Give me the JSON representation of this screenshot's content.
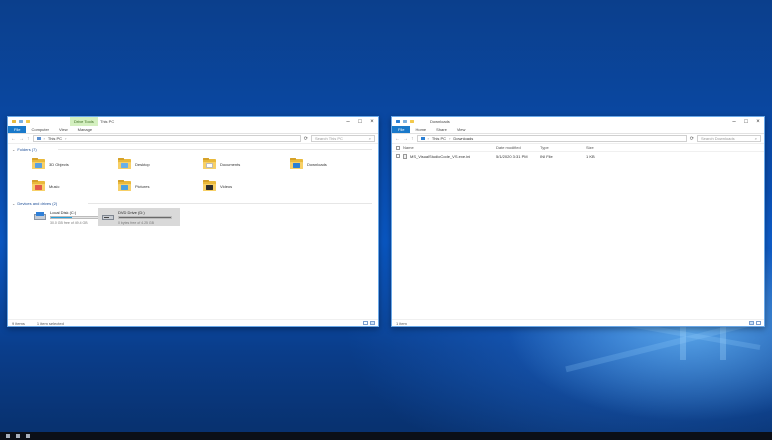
{
  "left_window": {
    "ribbon_context_tab": "Drive Tools",
    "title": "This PC",
    "tabs": [
      "File",
      "Computer",
      "View",
      "Manage"
    ],
    "address_path": "This PC",
    "search_placeholder": "Search This PC",
    "sections": {
      "folders_header": "Folders (7)",
      "drives_header": "Devices and drives (2)"
    },
    "folders": [
      {
        "label": "3D Objects",
        "icon": "3d-objects-folder-icon",
        "badge_color": "#5aa0e0"
      },
      {
        "label": "Desktop",
        "icon": "desktop-folder-icon",
        "badge_color": "#6ab0e8"
      },
      {
        "label": "Documents",
        "icon": "documents-folder-icon",
        "badge_color": "#ffffff"
      },
      {
        "label": "Downloads",
        "icon": "downloads-folder-icon",
        "badge_color": "#2a7fd4"
      },
      {
        "label": "Music",
        "icon": "music-folder-icon",
        "badge_color": "#e25a4a"
      },
      {
        "label": "Pictures",
        "icon": "pictures-folder-icon",
        "badge_color": "#4aa0e0"
      },
      {
        "label": "Videos",
        "icon": "videos-folder-icon",
        "badge_color": "#2c2c2c"
      }
    ],
    "drives": [
      {
        "label": "Local Disk (C:)",
        "sub": "30.0 GB free of 49.4 GB",
        "fill": 0.4,
        "icon": "local-disk-icon"
      },
      {
        "label": "DVD Drive (D:)",
        "sub": "0 bytes free of 4.25 GB",
        "fill": 1.0,
        "icon": "dvd-drive-icon"
      }
    ],
    "status": {
      "items": "9 items",
      "selected": "1 item selected"
    }
  },
  "right_window": {
    "title": "Downloads",
    "tabs": [
      "File",
      "Home",
      "Share",
      "View"
    ],
    "address_path": [
      "This PC",
      "Downloads"
    ],
    "search_placeholder": "Search Downloads",
    "columns": [
      "Name",
      "Date modified",
      "Type",
      "Size"
    ],
    "files": [
      {
        "name": "MS_VisualStudioCode_VS.exe.ini",
        "date": "5/1/2020 3:31 PM",
        "type": "INI File",
        "size": "1 KB"
      }
    ],
    "status": {
      "items": "1 item"
    }
  },
  "colors": {
    "accent": "#1979ca",
    "selection": "#d9d9d9",
    "bar_fill": "#26a0da"
  }
}
